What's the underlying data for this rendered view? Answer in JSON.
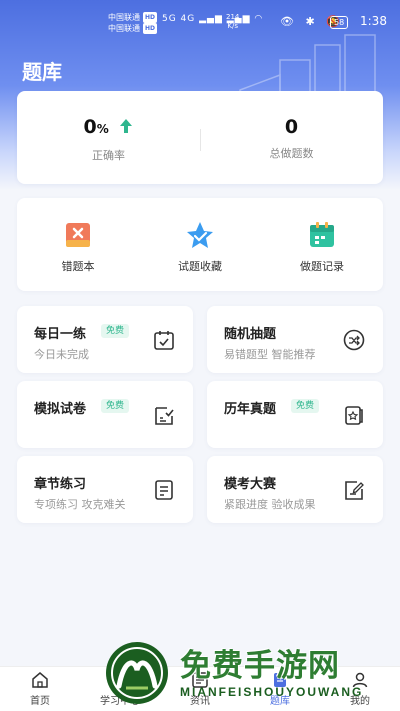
{
  "status_bar": {
    "carrier1": "中国联通",
    "carrier2": "中国联通",
    "hd": "HD",
    "signal": "5G 4G",
    "speed_value": "214",
    "speed_unit": "K/s",
    "battery": "58",
    "time": "1:38"
  },
  "header": {
    "title": "题库"
  },
  "stats": {
    "accuracy_value": "0",
    "accuracy_unit": "%",
    "accuracy_label": "正确率",
    "total_value": "0",
    "total_label": "总做题数"
  },
  "tools": [
    {
      "label": "错题本",
      "icon": "wrong-book-icon"
    },
    {
      "label": "试题收藏",
      "icon": "star-favorite-icon"
    },
    {
      "label": "做题记录",
      "icon": "calendar-record-icon"
    }
  ],
  "tiles": [
    {
      "title": "每日一练",
      "badge": "免费",
      "subtitle": "今日未完成",
      "icon": "calendar-check-icon"
    },
    {
      "title": "随机抽题",
      "badge": "",
      "subtitle": "易错题型 智能推荐",
      "icon": "shuffle-icon"
    },
    {
      "title": "模拟试卷",
      "badge": "免费",
      "subtitle": "",
      "icon": "paper-check-icon"
    },
    {
      "title": "历年真题",
      "badge": "免费",
      "subtitle": "",
      "icon": "archive-star-icon"
    },
    {
      "title": "章节练习",
      "badge": "",
      "subtitle": "专项练习 攻克难关",
      "icon": "document-icon"
    },
    {
      "title": "模考大赛",
      "badge": "",
      "subtitle": "紧跟进度 验收成果",
      "icon": "edit-paper-icon"
    }
  ],
  "tabbar": [
    {
      "label": "首页",
      "icon": "home-icon"
    },
    {
      "label": "学习中心",
      "icon": "play-icon"
    },
    {
      "label": "资讯",
      "icon": "news-icon"
    },
    {
      "label": "题库",
      "icon": "question-bank-icon"
    },
    {
      "label": "我的",
      "icon": "user-icon"
    }
  ],
  "watermark": {
    "title": "免费手游网",
    "subtitle": "MIANFEISHOUYOUWANG"
  },
  "colors": {
    "accent": "#4d6fe0",
    "badge": "#2fb68e",
    "watermark": "#2e7d32"
  }
}
